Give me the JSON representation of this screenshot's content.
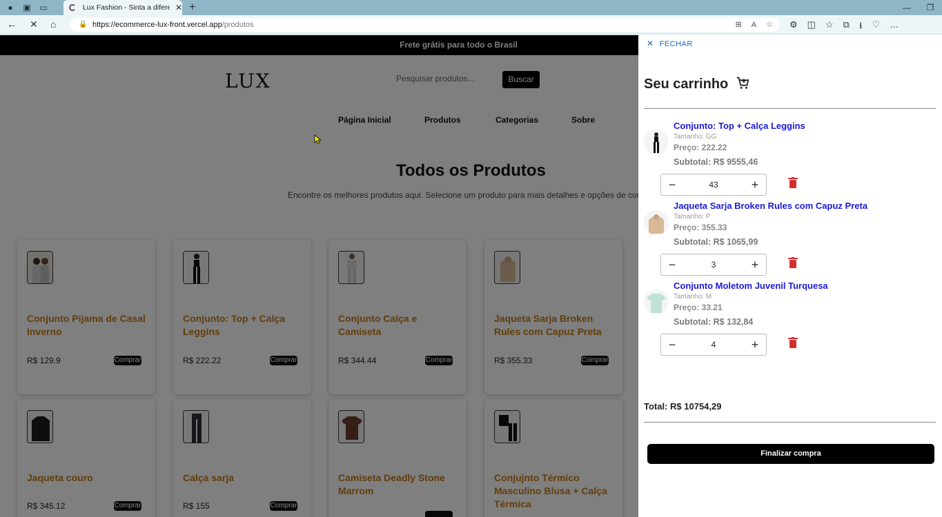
{
  "browser": {
    "tab_title": "Lux Fashion - Sinta a diferença d",
    "url_host": "https://ecommerce-lux-front.vercel.app",
    "url_path": "/produtos"
  },
  "page": {
    "announcement": "Frete grátis para todo o Brasil",
    "logo": "LUX",
    "search_placeholder": "Pesquisar produtos...",
    "search_button": "Buscar",
    "nav": [
      "Página Inicial",
      "Produtos",
      "Categorias",
      "Sobre"
    ],
    "heading": "Todos os Produtos",
    "subheading": "Encontre os melhores produtos aqui. Selecione um produto para mais detalhes e opções de compr",
    "buy_label": "Comprar",
    "products": [
      {
        "name": "Conjunto Pijama de Casal Inverno",
        "price": "R$ 129.9"
      },
      {
        "name": "Conjunto: Top + Calça Leggins",
        "price": "R$ 222.22"
      },
      {
        "name": "Conjunto Calça e Camiseta",
        "price": "R$ 344.44"
      },
      {
        "name": "Jaqueta Sarja Broken Rules com Capuz Preta",
        "price": "R$ 355.33"
      },
      {
        "name": "Jaqueta couro",
        "price": "R$ 345.12"
      },
      {
        "name": "Calça sarja",
        "price": "R$ 155"
      },
      {
        "name": "Camiseta Deadly Stone Marrom",
        "price": ""
      },
      {
        "name": "Conjujnto Térmico Masculino Blusa + Calça Térmica",
        "price": ""
      }
    ]
  },
  "cart": {
    "close_label": "FECHAR",
    "title": "Seu carrinho",
    "items": [
      {
        "name": "Conjunto: Top + Calça Leggins",
        "size": "Tamanho: GG",
        "price": "Preço: 222.22",
        "subtotal": "Subtotal: R$ 9555,46",
        "qty": "43"
      },
      {
        "name": "Jaqueta Sarja Broken Rules com Capuz Preta",
        "size": "Tamanho: P",
        "price": "Preço: 355.33",
        "subtotal": "Subtotal: R$ 1065,99",
        "qty": "3"
      },
      {
        "name": "Conjunto Moletom Juvenil Turquesa",
        "size": "Tamanho: M",
        "price": "Preço: 33.21",
        "subtotal": "Subtotal: R$ 132,84",
        "qty": "4"
      }
    ],
    "total": "Total: R$ 10754,29",
    "checkout_label": "Finalizar compra"
  },
  "colors": {
    "accent_link": "#1a1adc",
    "product_name": "#c57a14",
    "trash": "#d32f2f"
  }
}
